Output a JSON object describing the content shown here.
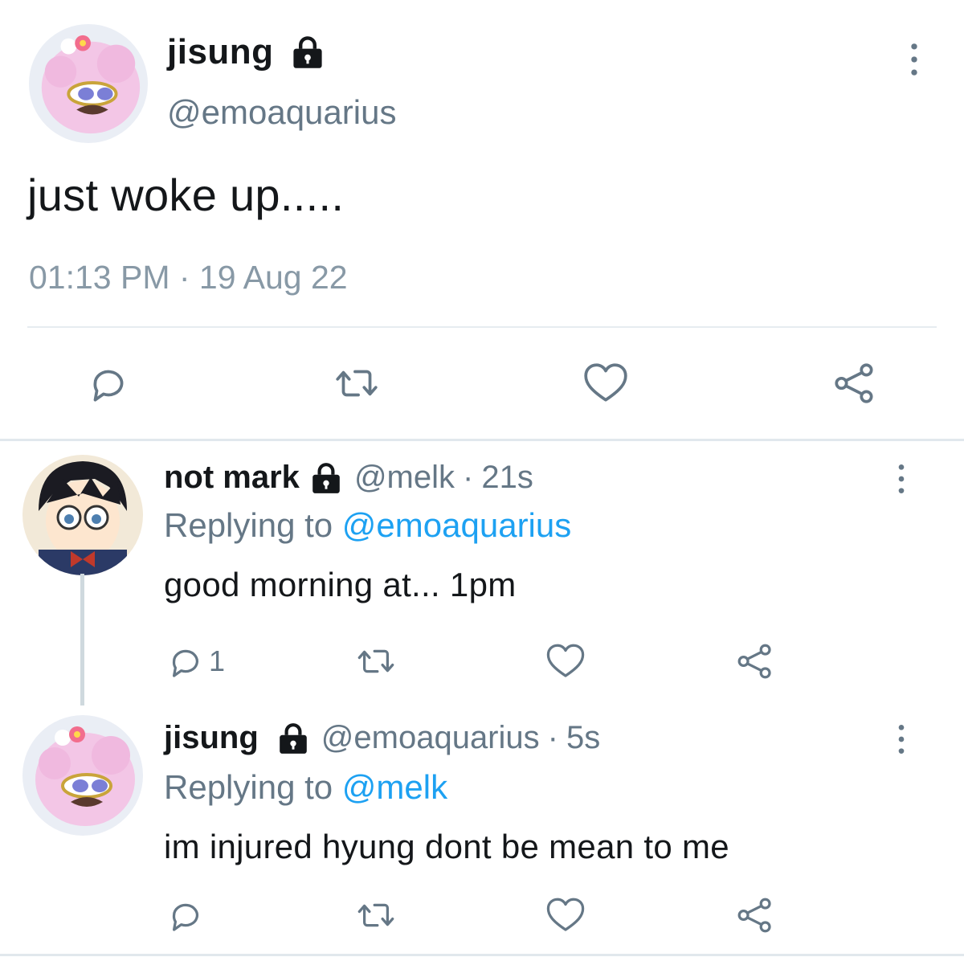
{
  "main_tweet": {
    "display_name": "jisung",
    "handle": "@emoaquarius",
    "text": "just woke up.....",
    "timestamp": "01:13 PM · 19 Aug 22",
    "actions": [
      "reply-icon",
      "retweet-icon",
      "like-icon",
      "share-icon"
    ]
  },
  "replies": [
    {
      "display_name": "not mark",
      "handle": "@melk",
      "separator": "·",
      "time": "21s",
      "replying_prefix": "Replying to",
      "replying_to": "@emoaquarius",
      "text": "good morning at... 1pm",
      "reply_count": "1"
    },
    {
      "display_name": "jisung",
      "handle": "@emoaquarius",
      "separator": "·",
      "time": "5s",
      "replying_prefix": "Replying to",
      "replying_to": "@melk",
      "text": "im injured hyung dont be mean to me",
      "reply_count": ""
    }
  ],
  "colors": {
    "text": "#14171a",
    "secondary": "#657786",
    "mention": "#1da1f2",
    "divider": "#e1e8ed",
    "avatar_pink": "#f3c6e6"
  }
}
